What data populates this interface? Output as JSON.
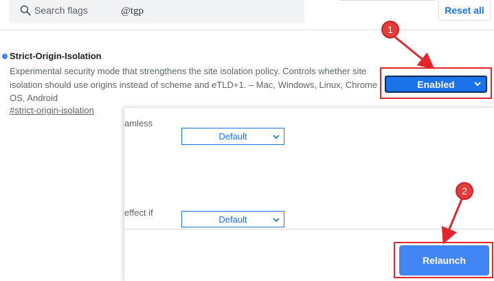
{
  "header": {
    "search_placeholder": "Search flags",
    "watermark": "@tgp",
    "reset_label": "Reset all"
  },
  "flag": {
    "title": "Strict-Origin-Isolation",
    "description": "Experimental security mode that strengthens the site isolation policy. Controls whether site isolation should use origins instead of scheme and eTLD+1. – Mac, Windows, Linux, Chrome OS, Android",
    "link": "#strict-origin-isolation",
    "selected_value": "Enabled"
  },
  "overlay": {
    "partial_text_1": "amless",
    "partial_text_2": "effect if",
    "select_1_value": "Default",
    "select_2_value": "Default",
    "relaunch_label": "Relaunch"
  },
  "annotations": {
    "badge_1": "1",
    "badge_2": "2",
    "highlight_color": "#e3242b"
  },
  "colors": {
    "accent": "#1a73e8",
    "relaunch": "#4285f4",
    "flag_dot": "#4285f4"
  }
}
